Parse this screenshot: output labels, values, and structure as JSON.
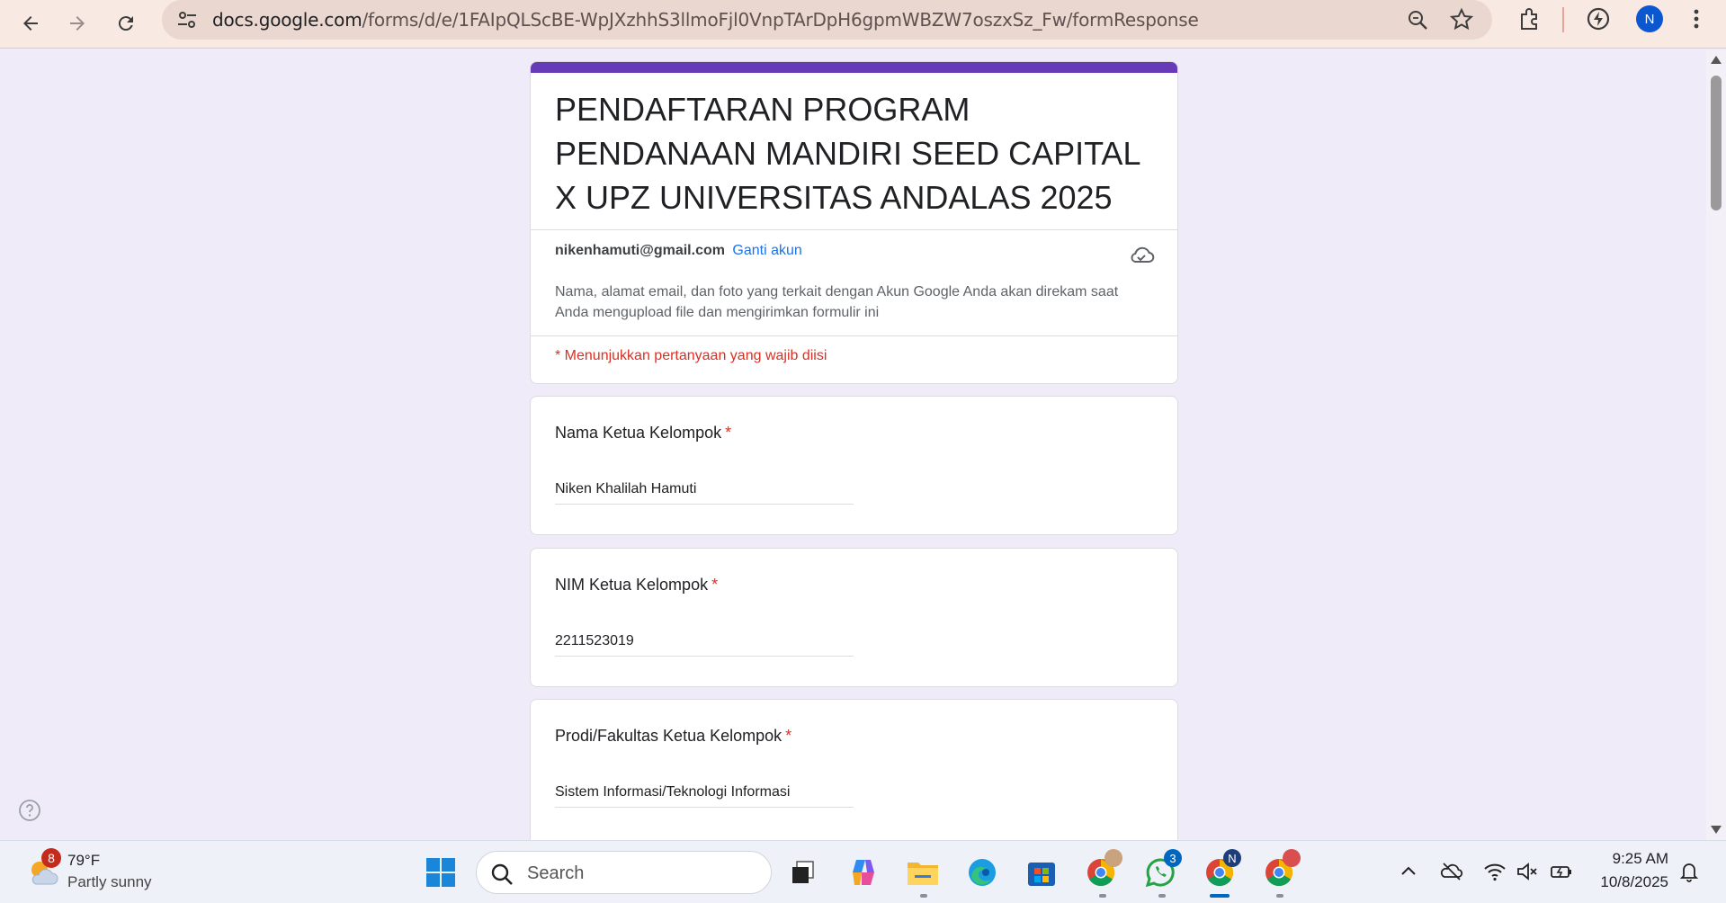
{
  "browser": {
    "url_host": "docs.google.com",
    "url_path": "/forms/d/e/1FAIpQLScBE-WpJXzhhS3llmoFjl0VnpTArDpH6gpmWBZW7oszxSz_Fw/formResponse",
    "profile_initial": "N"
  },
  "form": {
    "title": "PENDAFTARAN PROGRAM PENDANAAN MANDIRI SEED CAPITAL X UPZ UNIVERSITAS ANDALAS 2025",
    "account_email": "nikenhamuti@gmail.com",
    "switch_account": "Ganti akun",
    "account_note": "Nama, alamat email, dan foto yang terkait dengan Akun Google Anda akan direkam saat Anda mengupload file dan mengirimkan formulir ini",
    "required_note": "* Menunjukkan pertanyaan yang wajib diisi",
    "required_mark": "*",
    "questions": [
      {
        "label": "Nama Ketua Kelompok",
        "answer": "Niken Khalilah Hamuti"
      },
      {
        "label": "NIM Ketua Kelompok",
        "answer": "2211523019"
      },
      {
        "label": "Prodi/Fakultas Ketua Kelompok",
        "answer": "Sistem Informasi/Teknologi Informasi"
      }
    ]
  },
  "taskbar": {
    "weather_temp": "79°F",
    "weather_desc": "Partly sunny",
    "weather_badge": "8",
    "search_placeholder": "Search",
    "whatsapp_badge": "3",
    "chrome_profile_badge": "N",
    "time": "9:25 AM",
    "date": "10/8/2025"
  },
  "colors": {
    "accent": "#673ab7",
    "link": "#1a73e8",
    "required": "#d93025",
    "background": "#f0ebf8"
  }
}
